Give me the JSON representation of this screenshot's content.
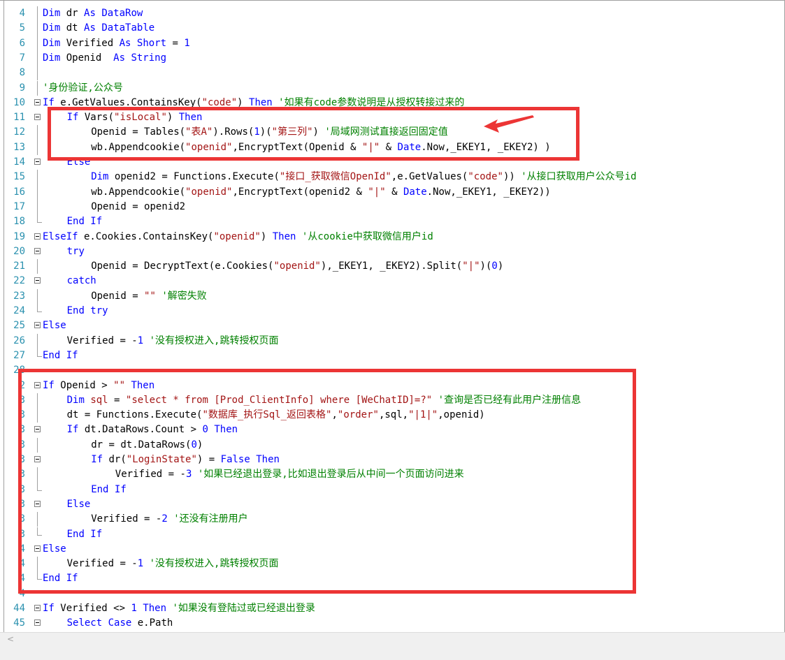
{
  "editor": {
    "lines": [
      {
        "n": "4",
        "indent": 0,
        "fold": "line",
        "tokens": [
          [
            "kw",
            "Dim"
          ],
          [
            "p",
            " dr "
          ],
          [
            "kw",
            "As"
          ],
          [
            "p",
            " "
          ],
          [
            "kw",
            "DataRow"
          ]
        ]
      },
      {
        "n": "5",
        "indent": 0,
        "fold": "line",
        "tokens": [
          [
            "kw",
            "Dim"
          ],
          [
            "p",
            " dt "
          ],
          [
            "kw",
            "As"
          ],
          [
            "p",
            " "
          ],
          [
            "kw",
            "DataTable"
          ]
        ]
      },
      {
        "n": "6",
        "indent": 0,
        "fold": "line",
        "tokens": [
          [
            "kw",
            "Dim"
          ],
          [
            "p",
            " Verified "
          ],
          [
            "kw",
            "As"
          ],
          [
            "p",
            " "
          ],
          [
            "kw",
            "Short"
          ],
          [
            "p",
            " = "
          ],
          [
            "num",
            "1"
          ]
        ]
      },
      {
        "n": "7",
        "indent": 0,
        "fold": "line",
        "tokens": [
          [
            "kw",
            "Dim"
          ],
          [
            "p",
            " Openid  "
          ],
          [
            "kw",
            "As"
          ],
          [
            "p",
            " "
          ],
          [
            "kw",
            "String"
          ]
        ]
      },
      {
        "n": "8",
        "indent": 0,
        "fold": "line",
        "tokens": []
      },
      {
        "n": "9",
        "indent": 0,
        "fold": "line",
        "tokens": [
          [
            "cmt",
            "'身份验证,公众号"
          ]
        ]
      },
      {
        "n": "10",
        "indent": 0,
        "fold": "box",
        "tokens": [
          [
            "kw",
            "If"
          ],
          [
            "p",
            " e.GetValues.ContainsKey("
          ],
          [
            "str",
            "\"code\""
          ],
          [
            "p",
            ") "
          ],
          [
            "kw",
            "Then"
          ],
          [
            "p",
            " "
          ],
          [
            "cmt",
            "'如果有code参数说明是从授权转接过来的"
          ]
        ]
      },
      {
        "n": "11",
        "indent": 1,
        "fold": "box",
        "tokens": [
          [
            "kw",
            "If"
          ],
          [
            "p",
            " Vars("
          ],
          [
            "str",
            "\"isLocal\""
          ],
          [
            "p",
            ") "
          ],
          [
            "kw",
            "Then"
          ]
        ]
      },
      {
        "n": "12",
        "indent": 2,
        "fold": "line",
        "tokens": [
          [
            "p",
            "Openid = Tables("
          ],
          [
            "str",
            "\"表A\""
          ],
          [
            "p",
            ").Rows("
          ],
          [
            "num",
            "1"
          ],
          [
            "p",
            ")("
          ],
          [
            "str",
            "\"第三列\""
          ],
          [
            "p",
            ") "
          ],
          [
            "cmt",
            "'局域网测试直接返回固定值"
          ]
        ]
      },
      {
        "n": "13",
        "indent": 2,
        "fold": "line",
        "tokens": [
          [
            "p",
            "wb.Appendcookie("
          ],
          [
            "str",
            "\"openid\""
          ],
          [
            "p",
            ",EncryptText(Openid & "
          ],
          [
            "str",
            "\"|\""
          ],
          [
            "p",
            " & "
          ],
          [
            "kw",
            "Date"
          ],
          [
            "p",
            ".Now,_EKEY1, _EKEY2) )"
          ]
        ]
      },
      {
        "n": "14",
        "indent": 1,
        "fold": "box",
        "tokens": [
          [
            "kw",
            "Else"
          ]
        ]
      },
      {
        "n": "15",
        "indent": 2,
        "fold": "line",
        "tokens": [
          [
            "kw",
            "Dim"
          ],
          [
            "p",
            " openid2 = Functions.Execute("
          ],
          [
            "str",
            "\"接口_获取微信OpenId\""
          ],
          [
            "p",
            ",e.GetValues("
          ],
          [
            "str",
            "\"code\""
          ],
          [
            "p",
            ")) "
          ],
          [
            "cmt",
            "'从接口获取用户公众号id"
          ]
        ]
      },
      {
        "n": "16",
        "indent": 2,
        "fold": "line",
        "tokens": [
          [
            "p",
            "wb.Appendcookie("
          ],
          [
            "str",
            "\"openid\""
          ],
          [
            "p",
            ",EncryptText(openid2 & "
          ],
          [
            "str",
            "\"|\""
          ],
          [
            "p",
            " & "
          ],
          [
            "kw",
            "Date"
          ],
          [
            "p",
            ".Now,_EKEY1, _EKEY2))"
          ]
        ]
      },
      {
        "n": "17",
        "indent": 2,
        "fold": "line",
        "tokens": [
          [
            "p",
            "Openid = openid2"
          ]
        ]
      },
      {
        "n": "18",
        "indent": 1,
        "fold": "end",
        "tokens": [
          [
            "kw",
            "End If"
          ]
        ]
      },
      {
        "n": "19",
        "indent": 0,
        "fold": "box",
        "tokens": [
          [
            "kw",
            "ElseIf"
          ],
          [
            "p",
            " e.Cookies.ContainsKey("
          ],
          [
            "str",
            "\"openid\""
          ],
          [
            "p",
            ") "
          ],
          [
            "kw",
            "Then"
          ],
          [
            "p",
            " "
          ],
          [
            "cmt",
            "'从cookie中获取微信用户id"
          ]
        ]
      },
      {
        "n": "20",
        "indent": 1,
        "fold": "box",
        "tokens": [
          [
            "kw",
            "try"
          ]
        ]
      },
      {
        "n": "21",
        "indent": 2,
        "fold": "line",
        "tokens": [
          [
            "p",
            "Openid = DecryptText(e.Cookies("
          ],
          [
            "str",
            "\"openid\""
          ],
          [
            "p",
            "),_EKEY1, _EKEY2).Split("
          ],
          [
            "str",
            "\"|\""
          ],
          [
            "p",
            ")("
          ],
          [
            "num",
            "0"
          ],
          [
            "p",
            ")"
          ]
        ]
      },
      {
        "n": "22",
        "indent": 1,
        "fold": "box",
        "tokens": [
          [
            "kw",
            "catch"
          ]
        ]
      },
      {
        "n": "23",
        "indent": 2,
        "fold": "line",
        "tokens": [
          [
            "p",
            "Openid = "
          ],
          [
            "str",
            "\"\""
          ],
          [
            "p",
            " "
          ],
          [
            "cmt",
            "'解密失败"
          ]
        ]
      },
      {
        "n": "24",
        "indent": 1,
        "fold": "end",
        "tokens": [
          [
            "kw",
            "End try"
          ]
        ]
      },
      {
        "n": "25",
        "indent": 0,
        "fold": "box",
        "tokens": [
          [
            "kw",
            "Else"
          ]
        ]
      },
      {
        "n": "26",
        "indent": 1,
        "fold": "line",
        "tokens": [
          [
            "p",
            "Verified = -"
          ],
          [
            "num",
            "1"
          ],
          [
            "p",
            " "
          ],
          [
            "cmt",
            "'没有授权进入,跳转授权页面"
          ]
        ]
      },
      {
        "n": "27",
        "indent": 0,
        "fold": "end",
        "tokens": [
          [
            "kw",
            "End If"
          ]
        ]
      },
      {
        "n": "28",
        "indent": 0,
        "fold": "none",
        "tokens": []
      },
      {
        "n": "29",
        "indent": 0,
        "fold": "box",
        "tokens": [
          [
            "kw",
            "If"
          ],
          [
            "p",
            " Openid > "
          ],
          [
            "str",
            "\"\""
          ],
          [
            "p",
            " "
          ],
          [
            "kw",
            "Then"
          ]
        ]
      },
      {
        "n": "30",
        "indent": 1,
        "fold": "line",
        "tokens": [
          [
            "kw",
            "Dim"
          ],
          [
            "p",
            " "
          ],
          [
            "str",
            "sql"
          ],
          [
            "p",
            " = "
          ],
          [
            "str",
            "\"select * from [Prod_ClientInfo] where [WeChatID]=?\""
          ],
          [
            "p",
            " "
          ],
          [
            "cmt",
            "'查询是否已经有此用户注册信息"
          ]
        ]
      },
      {
        "n": "31",
        "indent": 1,
        "fold": "line",
        "tokens": [
          [
            "p",
            "dt = Functions.Execute("
          ],
          [
            "str",
            "\"数据库_执行Sql_返回表格\""
          ],
          [
            "p",
            ","
          ],
          [
            "str",
            "\"order\""
          ],
          [
            "p",
            ",sql,"
          ],
          [
            "str",
            "\"|1|\""
          ],
          [
            "p",
            ",openid)"
          ]
        ]
      },
      {
        "n": "32",
        "indent": 1,
        "fold": "box",
        "tokens": [
          [
            "kw",
            "If"
          ],
          [
            "p",
            " dt.DataRows.Count > "
          ],
          [
            "num",
            "0"
          ],
          [
            "p",
            " "
          ],
          [
            "kw",
            "Then"
          ]
        ]
      },
      {
        "n": "33",
        "indent": 2,
        "fold": "line",
        "tokens": [
          [
            "p",
            "dr = dt.DataRows("
          ],
          [
            "num",
            "0"
          ],
          [
            "p",
            ")"
          ]
        ]
      },
      {
        "n": "34",
        "indent": 2,
        "fold": "box",
        "tokens": [
          [
            "kw",
            "If"
          ],
          [
            "p",
            " dr("
          ],
          [
            "str",
            "\"LoginState\""
          ],
          [
            "p",
            ") = "
          ],
          [
            "kw",
            "False"
          ],
          [
            "p",
            " "
          ],
          [
            "kw",
            "Then"
          ]
        ]
      },
      {
        "n": "35",
        "indent": 3,
        "fold": "line",
        "tokens": [
          [
            "p",
            "Verified = -"
          ],
          [
            "num",
            "3"
          ],
          [
            "p",
            " "
          ],
          [
            "cmt",
            "'如果已经退出登录,比如退出登录后从中间一个页面访问进来"
          ]
        ]
      },
      {
        "n": "36",
        "indent": 2,
        "fold": "end",
        "tokens": [
          [
            "kw",
            "End If"
          ]
        ]
      },
      {
        "n": "37",
        "indent": 1,
        "fold": "box",
        "tokens": [
          [
            "kw",
            "Else"
          ]
        ]
      },
      {
        "n": "38",
        "indent": 2,
        "fold": "line",
        "tokens": [
          [
            "p",
            "Verified = -"
          ],
          [
            "num",
            "2"
          ],
          [
            "p",
            " "
          ],
          [
            "cmt",
            "'还没有注册用户"
          ]
        ]
      },
      {
        "n": "39",
        "indent": 1,
        "fold": "end",
        "tokens": [
          [
            "kw",
            "End If"
          ]
        ]
      },
      {
        "n": "40",
        "indent": 0,
        "fold": "box",
        "tokens": [
          [
            "kw",
            "Else"
          ]
        ]
      },
      {
        "n": "41",
        "indent": 1,
        "fold": "line",
        "tokens": [
          [
            "p",
            "Verified = -"
          ],
          [
            "num",
            "1"
          ],
          [
            "p",
            " "
          ],
          [
            "cmt",
            "'没有授权进入,跳转授权页面"
          ]
        ]
      },
      {
        "n": "42",
        "indent": 0,
        "fold": "end",
        "tokens": [
          [
            "kw",
            "End If"
          ]
        ]
      },
      {
        "n": "43",
        "indent": 0,
        "fold": "none",
        "tokens": []
      },
      {
        "n": "44",
        "indent": 0,
        "fold": "box",
        "tokens": [
          [
            "kw",
            "If"
          ],
          [
            "p",
            " Verified <> "
          ],
          [
            "num",
            "1"
          ],
          [
            "p",
            " "
          ],
          [
            "kw",
            "Then"
          ],
          [
            "p",
            " "
          ],
          [
            "cmt",
            "'如果没有登陆过或已经退出登录"
          ]
        ]
      },
      {
        "n": "45",
        "indent": 1,
        "fold": "box",
        "tokens": [
          [
            "kw",
            "Select Case"
          ],
          [
            "p",
            " e.Path"
          ]
        ]
      }
    ],
    "line_number_overrides": {
      "29": "2",
      "30": "3",
      "31": "3",
      "32": "3",
      "33": "3",
      "34": "3",
      "35": "3",
      "36": "3",
      "37": "3",
      "38": "3",
      "39": "3",
      "40": "4",
      "41": "4",
      "42": "4",
      "43": "4"
    }
  },
  "scrollbar": {
    "left_arrow": "<"
  },
  "colors": {
    "keyword": "#0000ff",
    "string": "#a31515",
    "comment": "#008000",
    "highlight": "#ec3535",
    "line_number": "#2b91af"
  }
}
